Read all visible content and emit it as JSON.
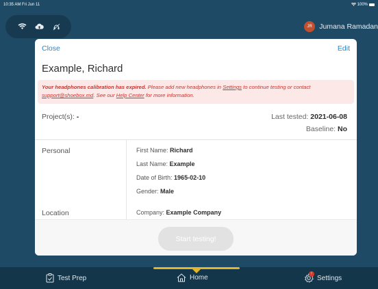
{
  "status_bar": {
    "time": "10:35 AM  Fri Jun 11",
    "battery": "100%"
  },
  "top_bar": {
    "user_initials": "JR",
    "user_name": "Jumana Ramadan"
  },
  "card": {
    "close_label": "Close",
    "edit_label": "Edit",
    "patient_name": "Example, Richard",
    "alert": {
      "bold_text": "Your headphones calibration has expired.",
      "text_1": " Please add new headphones in ",
      "settings_link": "Settings",
      "text_2": " to continue testing or contact ",
      "email_link": "support@shoebox.md",
      "text_3": ". See our ",
      "help_link": "Help Center",
      "text_4": " for more information."
    },
    "projects_label": "Project(s):",
    "projects_value": "-",
    "last_tested_label": "Last tested:",
    "last_tested_value": "2021-06-08",
    "baseline_label": "Baseline:",
    "baseline_value": "No",
    "personal": {
      "section_label": "Personal",
      "fields": [
        {
          "label": "First Name:",
          "value": "Richard"
        },
        {
          "label": "Last Name:",
          "value": "Example"
        },
        {
          "label": "Date of Birth:",
          "value": "1965-02-10"
        },
        {
          "label": "Gender:",
          "value": "Male"
        }
      ]
    },
    "location": {
      "section_label": "Location",
      "company_label": "Company:",
      "company_value": "Example Company"
    },
    "start_button": "Start testing!"
  },
  "tabs": [
    {
      "label": "Test Prep"
    },
    {
      "label": "Home"
    },
    {
      "label": "Settings",
      "badge": "!"
    }
  ],
  "colors": {
    "accent": "#2a85c8",
    "background": "#1f4a66",
    "tab_indicator": "#e3b32a",
    "alert_text": "#c7342f"
  }
}
